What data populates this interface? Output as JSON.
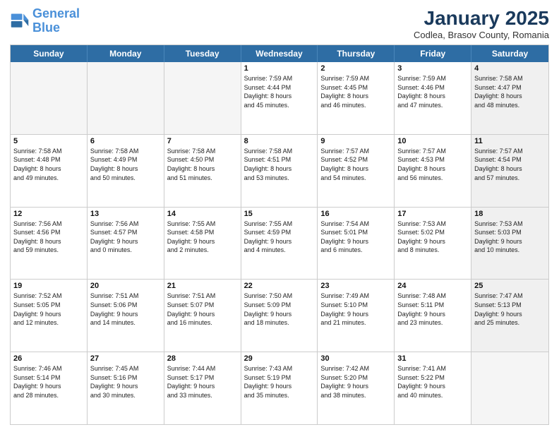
{
  "logo": {
    "line1": "General",
    "line2": "Blue"
  },
  "title": "January 2025",
  "location": "Codlea, Brasov County, Romania",
  "dayHeaders": [
    "Sunday",
    "Monday",
    "Tuesday",
    "Wednesday",
    "Thursday",
    "Friday",
    "Saturday"
  ],
  "weeks": [
    [
      {
        "day": "",
        "text": "",
        "empty": true
      },
      {
        "day": "",
        "text": "",
        "empty": true
      },
      {
        "day": "",
        "text": "",
        "empty": true
      },
      {
        "day": "1",
        "text": "Sunrise: 7:59 AM\nSunset: 4:44 PM\nDaylight: 8 hours\nand 45 minutes."
      },
      {
        "day": "2",
        "text": "Sunrise: 7:59 AM\nSunset: 4:45 PM\nDaylight: 8 hours\nand 46 minutes."
      },
      {
        "day": "3",
        "text": "Sunrise: 7:59 AM\nSunset: 4:46 PM\nDaylight: 8 hours\nand 47 minutes."
      },
      {
        "day": "4",
        "text": "Sunrise: 7:58 AM\nSunset: 4:47 PM\nDaylight: 8 hours\nand 48 minutes.",
        "shaded": true
      }
    ],
    [
      {
        "day": "5",
        "text": "Sunrise: 7:58 AM\nSunset: 4:48 PM\nDaylight: 8 hours\nand 49 minutes."
      },
      {
        "day": "6",
        "text": "Sunrise: 7:58 AM\nSunset: 4:49 PM\nDaylight: 8 hours\nand 50 minutes."
      },
      {
        "day": "7",
        "text": "Sunrise: 7:58 AM\nSunset: 4:50 PM\nDaylight: 8 hours\nand 51 minutes."
      },
      {
        "day": "8",
        "text": "Sunrise: 7:58 AM\nSunset: 4:51 PM\nDaylight: 8 hours\nand 53 minutes."
      },
      {
        "day": "9",
        "text": "Sunrise: 7:57 AM\nSunset: 4:52 PM\nDaylight: 8 hours\nand 54 minutes."
      },
      {
        "day": "10",
        "text": "Sunrise: 7:57 AM\nSunset: 4:53 PM\nDaylight: 8 hours\nand 56 minutes."
      },
      {
        "day": "11",
        "text": "Sunrise: 7:57 AM\nSunset: 4:54 PM\nDaylight: 8 hours\nand 57 minutes.",
        "shaded": true
      }
    ],
    [
      {
        "day": "12",
        "text": "Sunrise: 7:56 AM\nSunset: 4:56 PM\nDaylight: 8 hours\nand 59 minutes."
      },
      {
        "day": "13",
        "text": "Sunrise: 7:56 AM\nSunset: 4:57 PM\nDaylight: 9 hours\nand 0 minutes."
      },
      {
        "day": "14",
        "text": "Sunrise: 7:55 AM\nSunset: 4:58 PM\nDaylight: 9 hours\nand 2 minutes."
      },
      {
        "day": "15",
        "text": "Sunrise: 7:55 AM\nSunset: 4:59 PM\nDaylight: 9 hours\nand 4 minutes."
      },
      {
        "day": "16",
        "text": "Sunrise: 7:54 AM\nSunset: 5:01 PM\nDaylight: 9 hours\nand 6 minutes."
      },
      {
        "day": "17",
        "text": "Sunrise: 7:53 AM\nSunset: 5:02 PM\nDaylight: 9 hours\nand 8 minutes."
      },
      {
        "day": "18",
        "text": "Sunrise: 7:53 AM\nSunset: 5:03 PM\nDaylight: 9 hours\nand 10 minutes.",
        "shaded": true
      }
    ],
    [
      {
        "day": "19",
        "text": "Sunrise: 7:52 AM\nSunset: 5:05 PM\nDaylight: 9 hours\nand 12 minutes."
      },
      {
        "day": "20",
        "text": "Sunrise: 7:51 AM\nSunset: 5:06 PM\nDaylight: 9 hours\nand 14 minutes."
      },
      {
        "day": "21",
        "text": "Sunrise: 7:51 AM\nSunset: 5:07 PM\nDaylight: 9 hours\nand 16 minutes."
      },
      {
        "day": "22",
        "text": "Sunrise: 7:50 AM\nSunset: 5:09 PM\nDaylight: 9 hours\nand 18 minutes."
      },
      {
        "day": "23",
        "text": "Sunrise: 7:49 AM\nSunset: 5:10 PM\nDaylight: 9 hours\nand 21 minutes."
      },
      {
        "day": "24",
        "text": "Sunrise: 7:48 AM\nSunset: 5:11 PM\nDaylight: 9 hours\nand 23 minutes."
      },
      {
        "day": "25",
        "text": "Sunrise: 7:47 AM\nSunset: 5:13 PM\nDaylight: 9 hours\nand 25 minutes.",
        "shaded": true
      }
    ],
    [
      {
        "day": "26",
        "text": "Sunrise: 7:46 AM\nSunset: 5:14 PM\nDaylight: 9 hours\nand 28 minutes."
      },
      {
        "day": "27",
        "text": "Sunrise: 7:45 AM\nSunset: 5:16 PM\nDaylight: 9 hours\nand 30 minutes."
      },
      {
        "day": "28",
        "text": "Sunrise: 7:44 AM\nSunset: 5:17 PM\nDaylight: 9 hours\nand 33 minutes."
      },
      {
        "day": "29",
        "text": "Sunrise: 7:43 AM\nSunset: 5:19 PM\nDaylight: 9 hours\nand 35 minutes."
      },
      {
        "day": "30",
        "text": "Sunrise: 7:42 AM\nSunset: 5:20 PM\nDaylight: 9 hours\nand 38 minutes."
      },
      {
        "day": "31",
        "text": "Sunrise: 7:41 AM\nSunset: 5:22 PM\nDaylight: 9 hours\nand 40 minutes."
      },
      {
        "day": "",
        "text": "",
        "empty": true,
        "shaded": true
      }
    ]
  ]
}
